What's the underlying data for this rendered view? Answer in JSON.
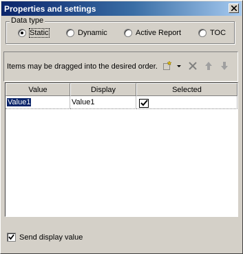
{
  "window": {
    "title": "Properties and settings"
  },
  "data_type": {
    "legend": "Data type",
    "options": [
      {
        "label": "Static",
        "checked": true
      },
      {
        "label": "Dynamic",
        "checked": false
      },
      {
        "label": "Active Report",
        "checked": false
      },
      {
        "label": "TOC",
        "checked": false
      }
    ]
  },
  "toolbar": {
    "hint": "Items may be dragged into the desired order.",
    "icons": [
      "new-item-icon",
      "dropdown-arrow-icon",
      "delete-icon",
      "move-up-icon",
      "move-down-icon"
    ]
  },
  "grid": {
    "columns": [
      "Value",
      "Display",
      "Selected"
    ],
    "rows": [
      {
        "value": "Value1",
        "display": "Value1",
        "selected": true
      }
    ]
  },
  "options": {
    "send_display_value": "Send display value",
    "send_display_checked": true
  },
  "colors": {
    "title_start": "#0a246a",
    "title_end": "#a6caf0",
    "face": "#d4d0c8",
    "selection": "#0a246a"
  }
}
